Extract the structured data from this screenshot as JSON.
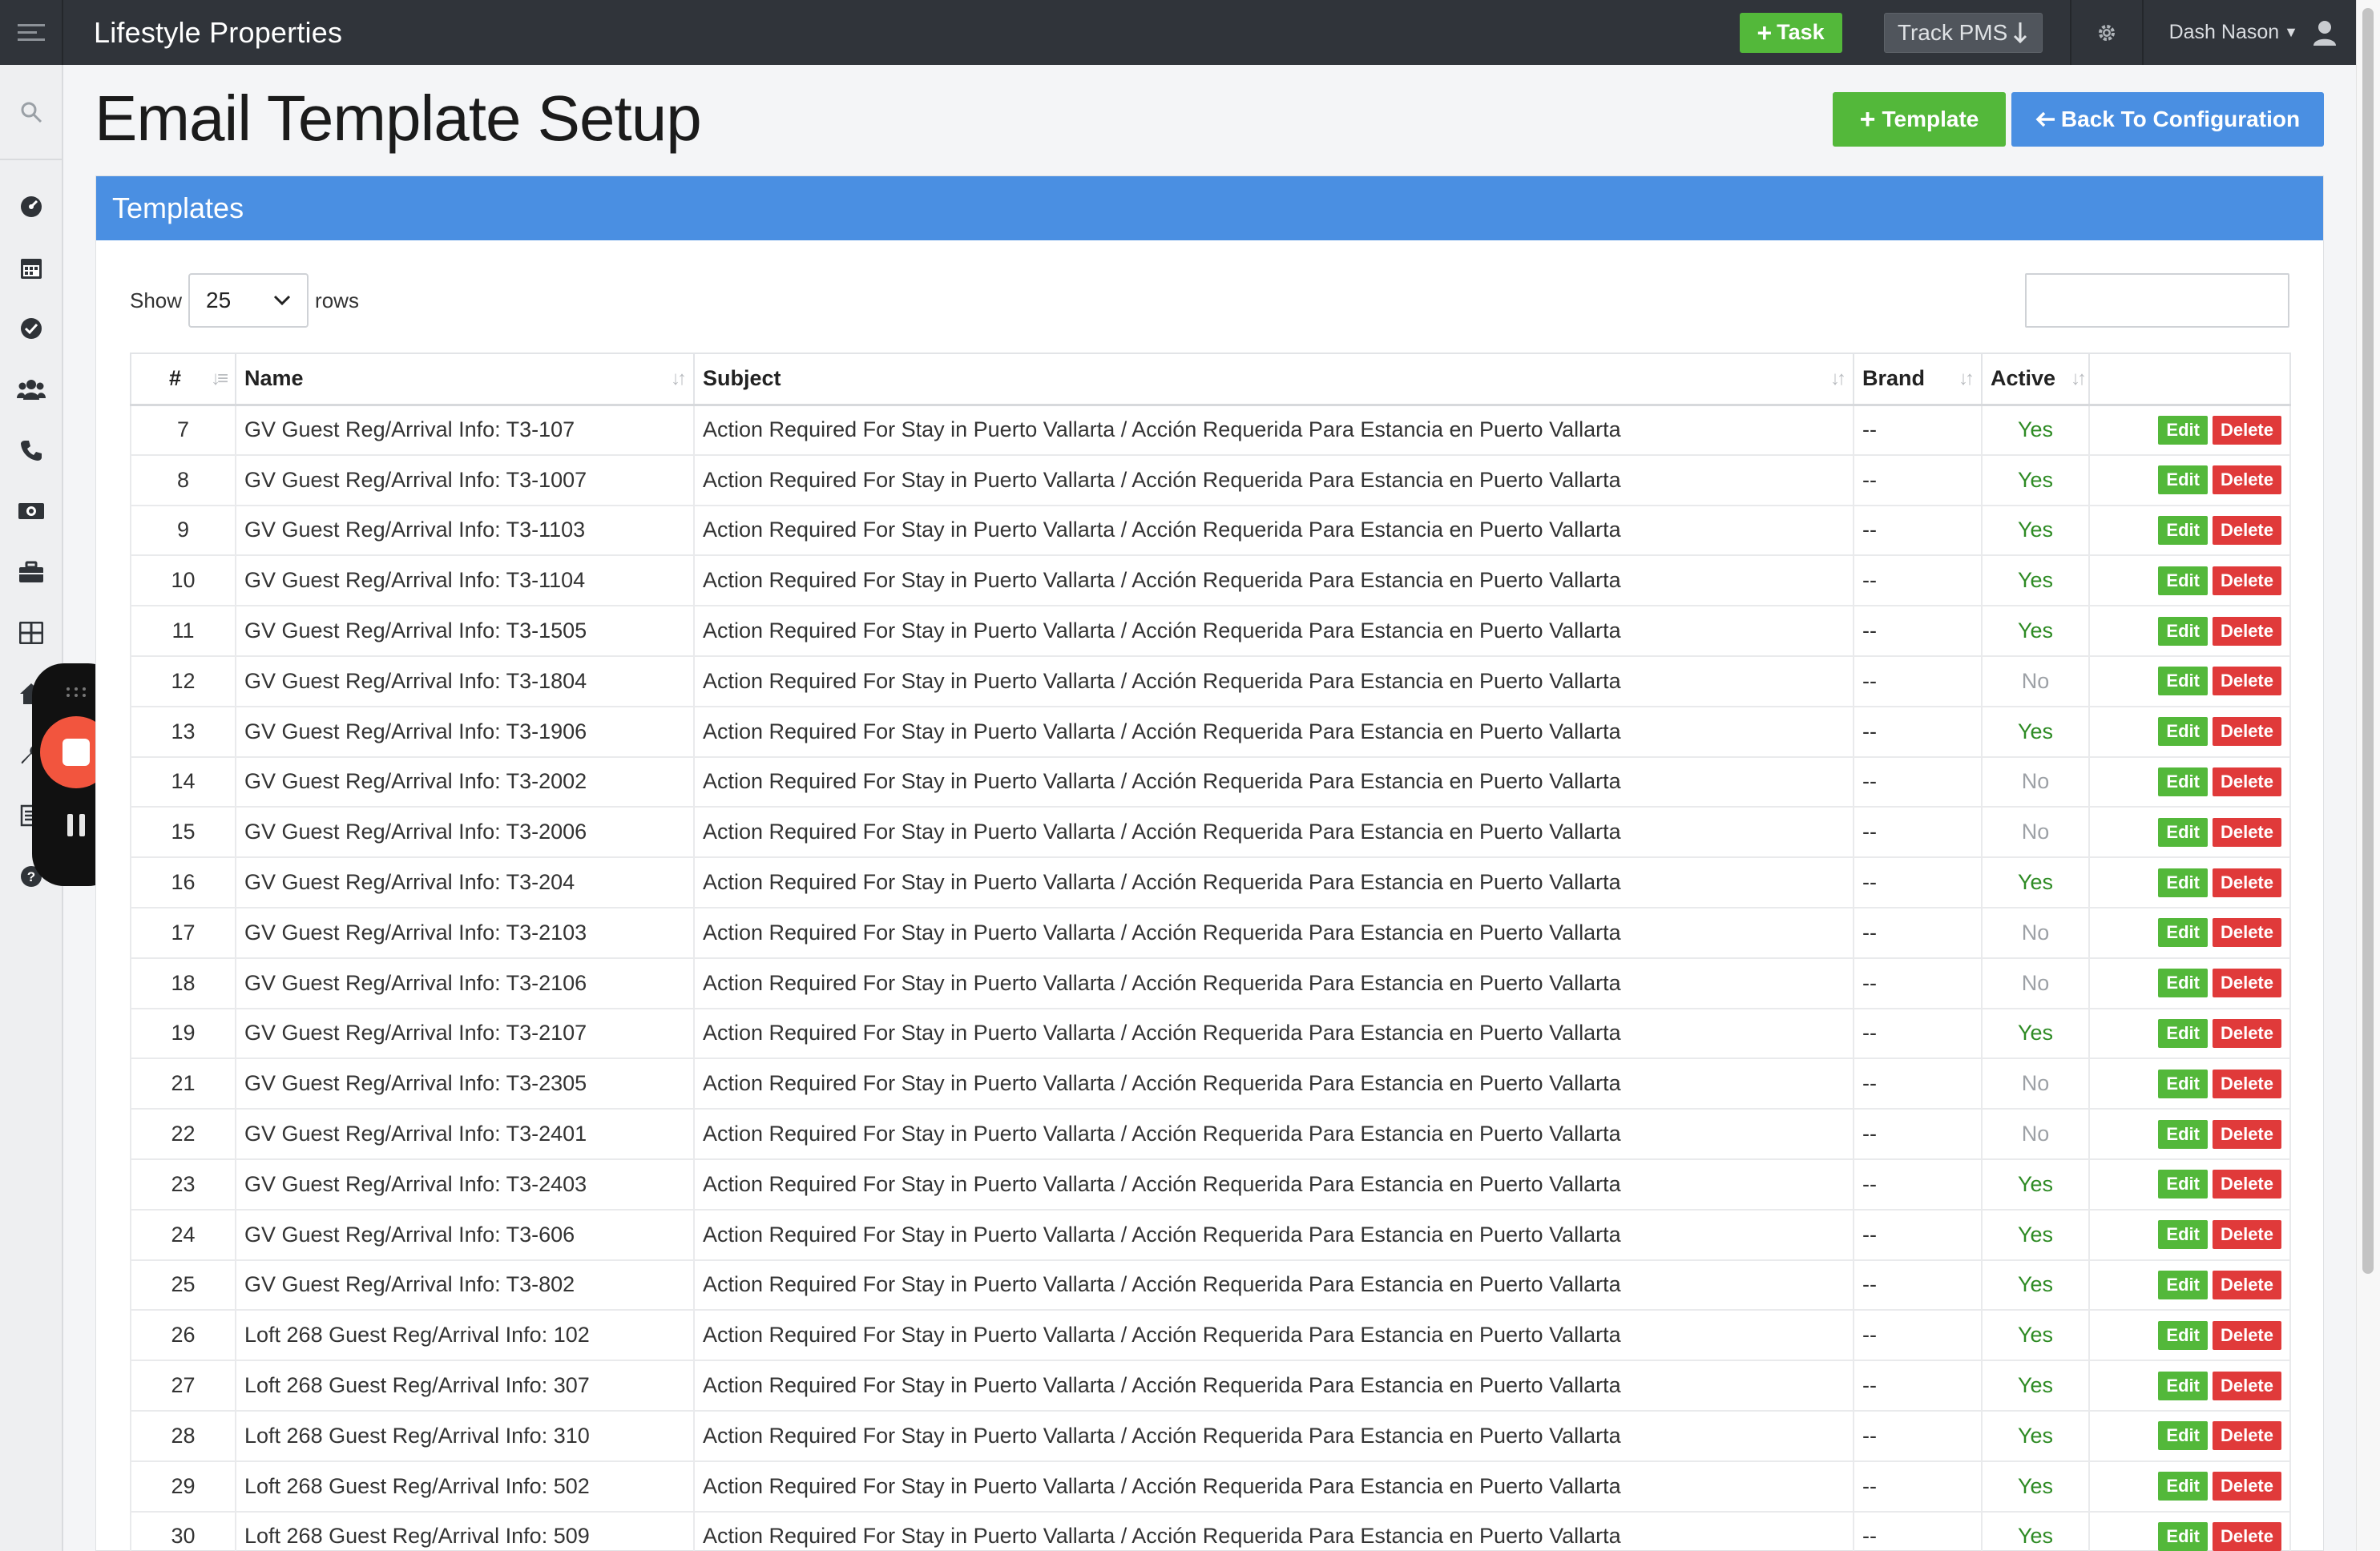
{
  "app": {
    "brand": "Lifestyle Properties"
  },
  "topbar": {
    "task_label": "Task",
    "track_label": "Track PMS",
    "user_name": "Dash Nason"
  },
  "page": {
    "title": "Email Template Setup",
    "add_template_label": "Template",
    "back_label": "Back To Configuration"
  },
  "panel": {
    "title": "Templates"
  },
  "controls": {
    "show_label": "Show",
    "rows_value": "25",
    "rows_label": "rows",
    "search_value": ""
  },
  "table": {
    "columns": [
      "#",
      "Name",
      "Subject",
      "Brand",
      "Active",
      ""
    ],
    "edit_label": "Edit",
    "delete_label": "Delete",
    "rows": [
      {
        "id": "7",
        "name": "GV Guest Reg/Arrival Info: T3-107",
        "subject": "Action Required For Stay in Puerto Vallarta / Acción Requerida Para Estancia en Puerto Vallarta",
        "brand": "--",
        "active": "Yes"
      },
      {
        "id": "8",
        "name": "GV Guest Reg/Arrival Info: T3-1007",
        "subject": "Action Required For Stay in Puerto Vallarta / Acción Requerida Para Estancia en Puerto Vallarta",
        "brand": "--",
        "active": "Yes"
      },
      {
        "id": "9",
        "name": "GV Guest Reg/Arrival Info: T3-1103",
        "subject": "Action Required For Stay in Puerto Vallarta / Acción Requerida Para Estancia en Puerto Vallarta",
        "brand": "--",
        "active": "Yes"
      },
      {
        "id": "10",
        "name": "GV Guest Reg/Arrival Info: T3-1104",
        "subject": "Action Required For Stay in Puerto Vallarta / Acción Requerida Para Estancia en Puerto Vallarta",
        "brand": "--",
        "active": "Yes"
      },
      {
        "id": "11",
        "name": "GV Guest Reg/Arrival Info: T3-1505",
        "subject": "Action Required For Stay in Puerto Vallarta / Acción Requerida Para Estancia en Puerto Vallarta",
        "brand": "--",
        "active": "Yes"
      },
      {
        "id": "12",
        "name": "GV Guest Reg/Arrival Info: T3-1804",
        "subject": "Action Required For Stay in Puerto Vallarta / Acción Requerida Para Estancia en Puerto Vallarta",
        "brand": "--",
        "active": "No"
      },
      {
        "id": "13",
        "name": "GV Guest Reg/Arrival Info: T3-1906",
        "subject": "Action Required For Stay in Puerto Vallarta / Acción Requerida Para Estancia en Puerto Vallarta",
        "brand": "--",
        "active": "Yes"
      },
      {
        "id": "14",
        "name": "GV Guest Reg/Arrival Info: T3-2002",
        "subject": "Action Required For Stay in Puerto Vallarta / Acción Requerida Para Estancia en Puerto Vallarta",
        "brand": "--",
        "active": "No"
      },
      {
        "id": "15",
        "name": "GV Guest Reg/Arrival Info: T3-2006",
        "subject": "Action Required For Stay in Puerto Vallarta / Acción Requerida Para Estancia en Puerto Vallarta",
        "brand": "--",
        "active": "No"
      },
      {
        "id": "16",
        "name": "GV Guest Reg/Arrival Info: T3-204",
        "subject": "Action Required For Stay in Puerto Vallarta / Acción Requerida Para Estancia en Puerto Vallarta",
        "brand": "--",
        "active": "Yes"
      },
      {
        "id": "17",
        "name": "GV Guest Reg/Arrival Info: T3-2103",
        "subject": "Action Required For Stay in Puerto Vallarta / Acción Requerida Para Estancia en Puerto Vallarta",
        "brand": "--",
        "active": "No"
      },
      {
        "id": "18",
        "name": "GV Guest Reg/Arrival Info: T3-2106",
        "subject": "Action Required For Stay in Puerto Vallarta / Acción Requerida Para Estancia en Puerto Vallarta",
        "brand": "--",
        "active": "No"
      },
      {
        "id": "19",
        "name": "GV Guest Reg/Arrival Info: T3-2107",
        "subject": "Action Required For Stay in Puerto Vallarta / Acción Requerida Para Estancia en Puerto Vallarta",
        "brand": "--",
        "active": "Yes"
      },
      {
        "id": "21",
        "name": "GV Guest Reg/Arrival Info: T3-2305",
        "subject": "Action Required For Stay in Puerto Vallarta / Acción Requerida Para Estancia en Puerto Vallarta",
        "brand": "--",
        "active": "No"
      },
      {
        "id": "22",
        "name": "GV Guest Reg/Arrival Info: T3-2401",
        "subject": "Action Required For Stay in Puerto Vallarta / Acción Requerida Para Estancia en Puerto Vallarta",
        "brand": "--",
        "active": "No"
      },
      {
        "id": "23",
        "name": "GV Guest Reg/Arrival Info: T3-2403",
        "subject": "Action Required For Stay in Puerto Vallarta / Acción Requerida Para Estancia en Puerto Vallarta",
        "brand": "--",
        "active": "Yes"
      },
      {
        "id": "24",
        "name": "GV Guest Reg/Arrival Info: T3-606",
        "subject": "Action Required For Stay in Puerto Vallarta / Acción Requerida Para Estancia en Puerto Vallarta",
        "brand": "--",
        "active": "Yes"
      },
      {
        "id": "25",
        "name": "GV Guest Reg/Arrival Info: T3-802",
        "subject": "Action Required For Stay in Puerto Vallarta / Acción Requerida Para Estancia en Puerto Vallarta",
        "brand": "--",
        "active": "Yes"
      },
      {
        "id": "26",
        "name": "Loft 268 Guest Reg/Arrival Info: 102",
        "subject": "Action Required For Stay in Puerto Vallarta / Acción Requerida Para Estancia en Puerto Vallarta",
        "brand": "--",
        "active": "Yes"
      },
      {
        "id": "27",
        "name": "Loft 268 Guest Reg/Arrival Info: 307",
        "subject": "Action Required For Stay in Puerto Vallarta / Acción Requerida Para Estancia en Puerto Vallarta",
        "brand": "--",
        "active": "Yes"
      },
      {
        "id": "28",
        "name": "Loft 268 Guest Reg/Arrival Info: 310",
        "subject": "Action Required For Stay in Puerto Vallarta / Acción Requerida Para Estancia en Puerto Vallarta",
        "brand": "--",
        "active": "Yes"
      },
      {
        "id": "29",
        "name": "Loft 268 Guest Reg/Arrival Info: 502",
        "subject": "Action Required For Stay in Puerto Vallarta / Acción Requerida Para Estancia en Puerto Vallarta",
        "brand": "--",
        "active": "Yes"
      },
      {
        "id": "30",
        "name": "Loft 268 Guest Reg/Arrival Info: 509",
        "subject": "Action Required For Stay in Puerto Vallarta / Acción Requerida Para Estancia en Puerto Vallarta",
        "brand": "--",
        "active": "Yes"
      }
    ]
  },
  "colors": {
    "topbar": "#30343a",
    "accent_green": "#53b83a",
    "accent_blue": "#4a8fe2",
    "danger": "#e03a3a",
    "yes": "#2e8b24",
    "no": "#9da1a6"
  },
  "icons": {
    "sidebar": [
      "search-icon",
      "dashboard-icon",
      "calendar-icon",
      "check-circle-icon",
      "users-icon",
      "phone-icon",
      "money-icon",
      "briefcase-icon",
      "grid-icon",
      "home-icon",
      "wrench-icon",
      "list-icon",
      "help-icon"
    ]
  }
}
